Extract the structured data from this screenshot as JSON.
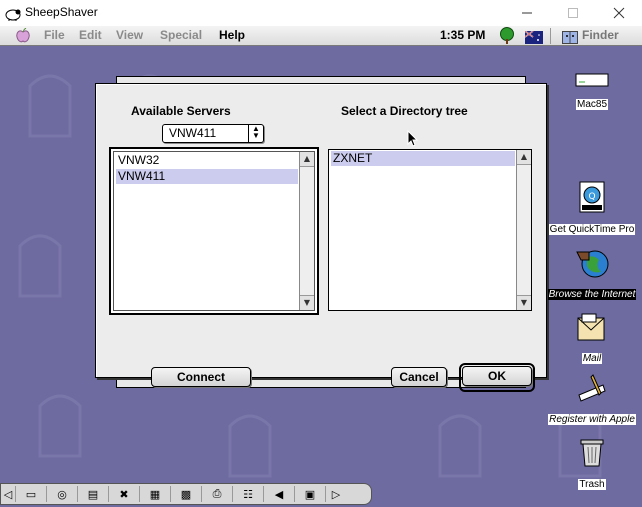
{
  "host_window": {
    "title": "SheepShaver",
    "controls": [
      "minimize",
      "maximize",
      "close"
    ]
  },
  "menubar": {
    "items": [
      {
        "label": "File",
        "active": false
      },
      {
        "label": "Edit",
        "active": false
      },
      {
        "label": "View",
        "active": false
      },
      {
        "label": "Special",
        "active": false
      },
      {
        "label": "Help",
        "active": true
      }
    ],
    "clock": "1:35 PM",
    "app_menu": "Finder"
  },
  "dialog": {
    "servers_title": "Available Servers",
    "server_popup_value": "VNW411",
    "servers": [
      {
        "label": "VNW32",
        "selected": false
      },
      {
        "label": "VNW411",
        "selected": true
      }
    ],
    "directory_title": "Select a Directory tree",
    "directories": [
      {
        "label": "ZXNET",
        "selected": true
      }
    ],
    "connect_label": "Connect",
    "cancel_label": "Cancel",
    "ok_label": "OK"
  },
  "desktop_icons": [
    {
      "label": "Mac85",
      "icon": "hard-disk-icon"
    },
    {
      "label": "Get QuickTime Pro",
      "icon": "quicktime-movie-icon"
    },
    {
      "label": "Browse the Internet",
      "icon": "internet-globe-icon"
    },
    {
      "label": "Mail",
      "icon": "mail-icon"
    },
    {
      "label": "Register with Apple",
      "icon": "register-pen-icon"
    },
    {
      "label": "Trash",
      "icon": "trash-icon"
    }
  ],
  "colors": {
    "desktop": "#6e6ba0",
    "selection": "#ccccee"
  }
}
